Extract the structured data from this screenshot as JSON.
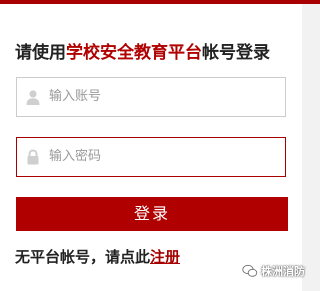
{
  "colors": {
    "accent": "#b00000",
    "top_bar": "#a80000",
    "background": "#f2f2f2"
  },
  "login": {
    "title_prefix": "请使用",
    "title_highlight": "学校安全教育平台",
    "title_suffix": "帐号登录",
    "username": {
      "icon": "user-icon",
      "placeholder": "输入账号",
      "value": ""
    },
    "password": {
      "icon": "lock-icon",
      "placeholder": "输入密码",
      "value": ""
    },
    "login_button_label": "登录",
    "register_prompt": "无平台帐号，请点此",
    "register_link_label": "注册"
  },
  "watermark": {
    "icon": "wechat-icon",
    "text": "株洲消防"
  }
}
